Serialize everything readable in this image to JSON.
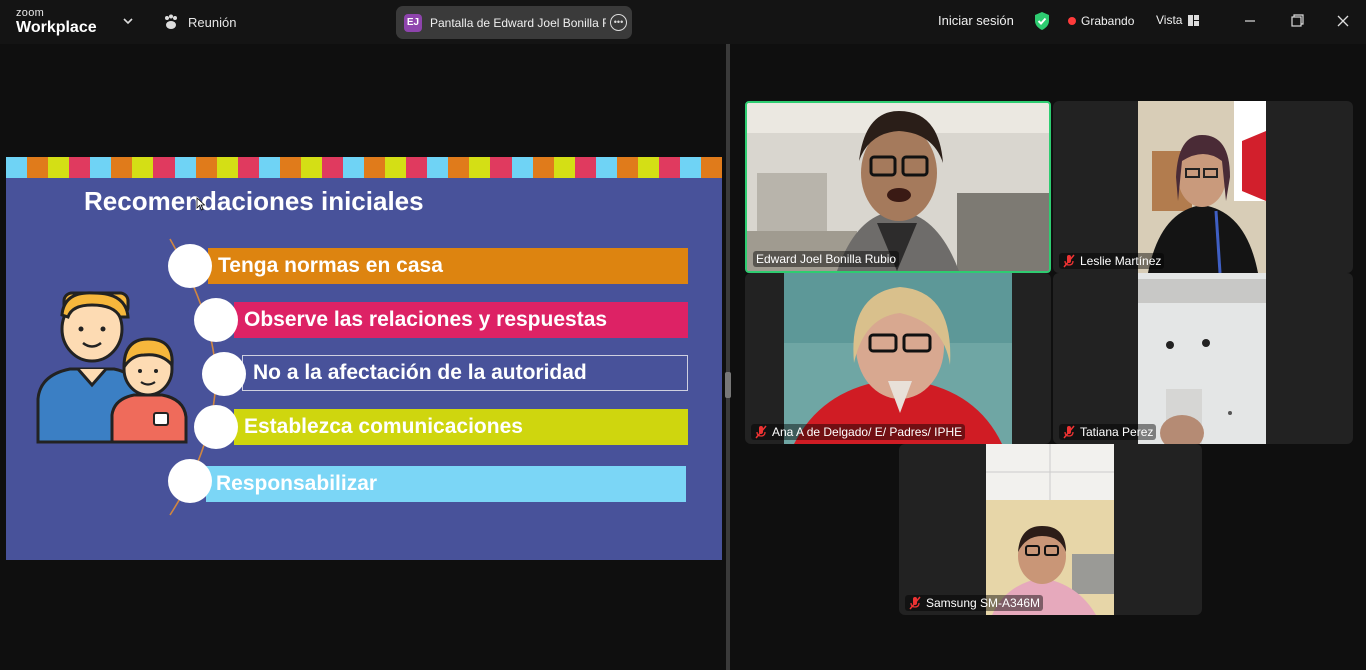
{
  "app": {
    "brand_top": "zoom",
    "brand_bottom": "Workplace",
    "meeting_label": "Reunión",
    "share_initials": "EJ",
    "share_title": "Pantalla de Edward Joel Bonilla R",
    "signin_label": "Iniciar sesión",
    "recording_label": "Grabando",
    "view_label": "Vista"
  },
  "colors": {
    "accent_green": "#2ecc71",
    "recording_red": "#ff3b3b",
    "badge_purple": "#8e44ad",
    "slide_bg": "#48529a"
  },
  "slide": {
    "title": "Recomendaciones iniciales",
    "stripe_colors": [
      "#6fd3f5",
      "#e07b1b",
      "#d4df15",
      "#e03a5f",
      "#6fd3f5",
      "#e07b1b",
      "#d4df15",
      "#e03a5f",
      "#6fd3f5",
      "#e07b1b",
      "#d4df15",
      "#e03a5f",
      "#6fd3f5",
      "#e07b1b",
      "#d4df15",
      "#e03a5f",
      "#6fd3f5",
      "#e07b1b",
      "#d4df15",
      "#e03a5f",
      "#6fd3f5",
      "#e07b1b",
      "#d4df15",
      "#e03a5f",
      "#6fd3f5",
      "#e07b1b",
      "#d4df15",
      "#e03a5f",
      "#6fd3f5",
      "#e07b1b",
      "#d4df15",
      "#e03a5f",
      "#6fd3f5",
      "#e07b1b"
    ],
    "items": [
      {
        "label": "Tenga normas en casa",
        "color": "#dd8410"
      },
      {
        "label": "Observe las relaciones y respuestas",
        "color": "#dd2265"
      },
      {
        "label": "No a la afectación de la autoridad",
        "color": "#48529a"
      },
      {
        "label": "Establezca comunicaciones",
        "color": "#cfd60e"
      },
      {
        "label": "Responsabilizar",
        "color": "#7bd6f6"
      }
    ]
  },
  "participants": [
    {
      "name": "Edward Joel Bonilla Rubio",
      "muted": false,
      "active": true
    },
    {
      "name": "Leslie Martínez",
      "muted": true,
      "active": false
    },
    {
      "name": "Ana A de Delgado/ E/ Padres/ IPHE",
      "muted": true,
      "active": false
    },
    {
      "name": "Tatiana Perez",
      "muted": true,
      "active": false
    },
    {
      "name": "Samsung SM-A346M",
      "muted": true,
      "active": false
    }
  ]
}
